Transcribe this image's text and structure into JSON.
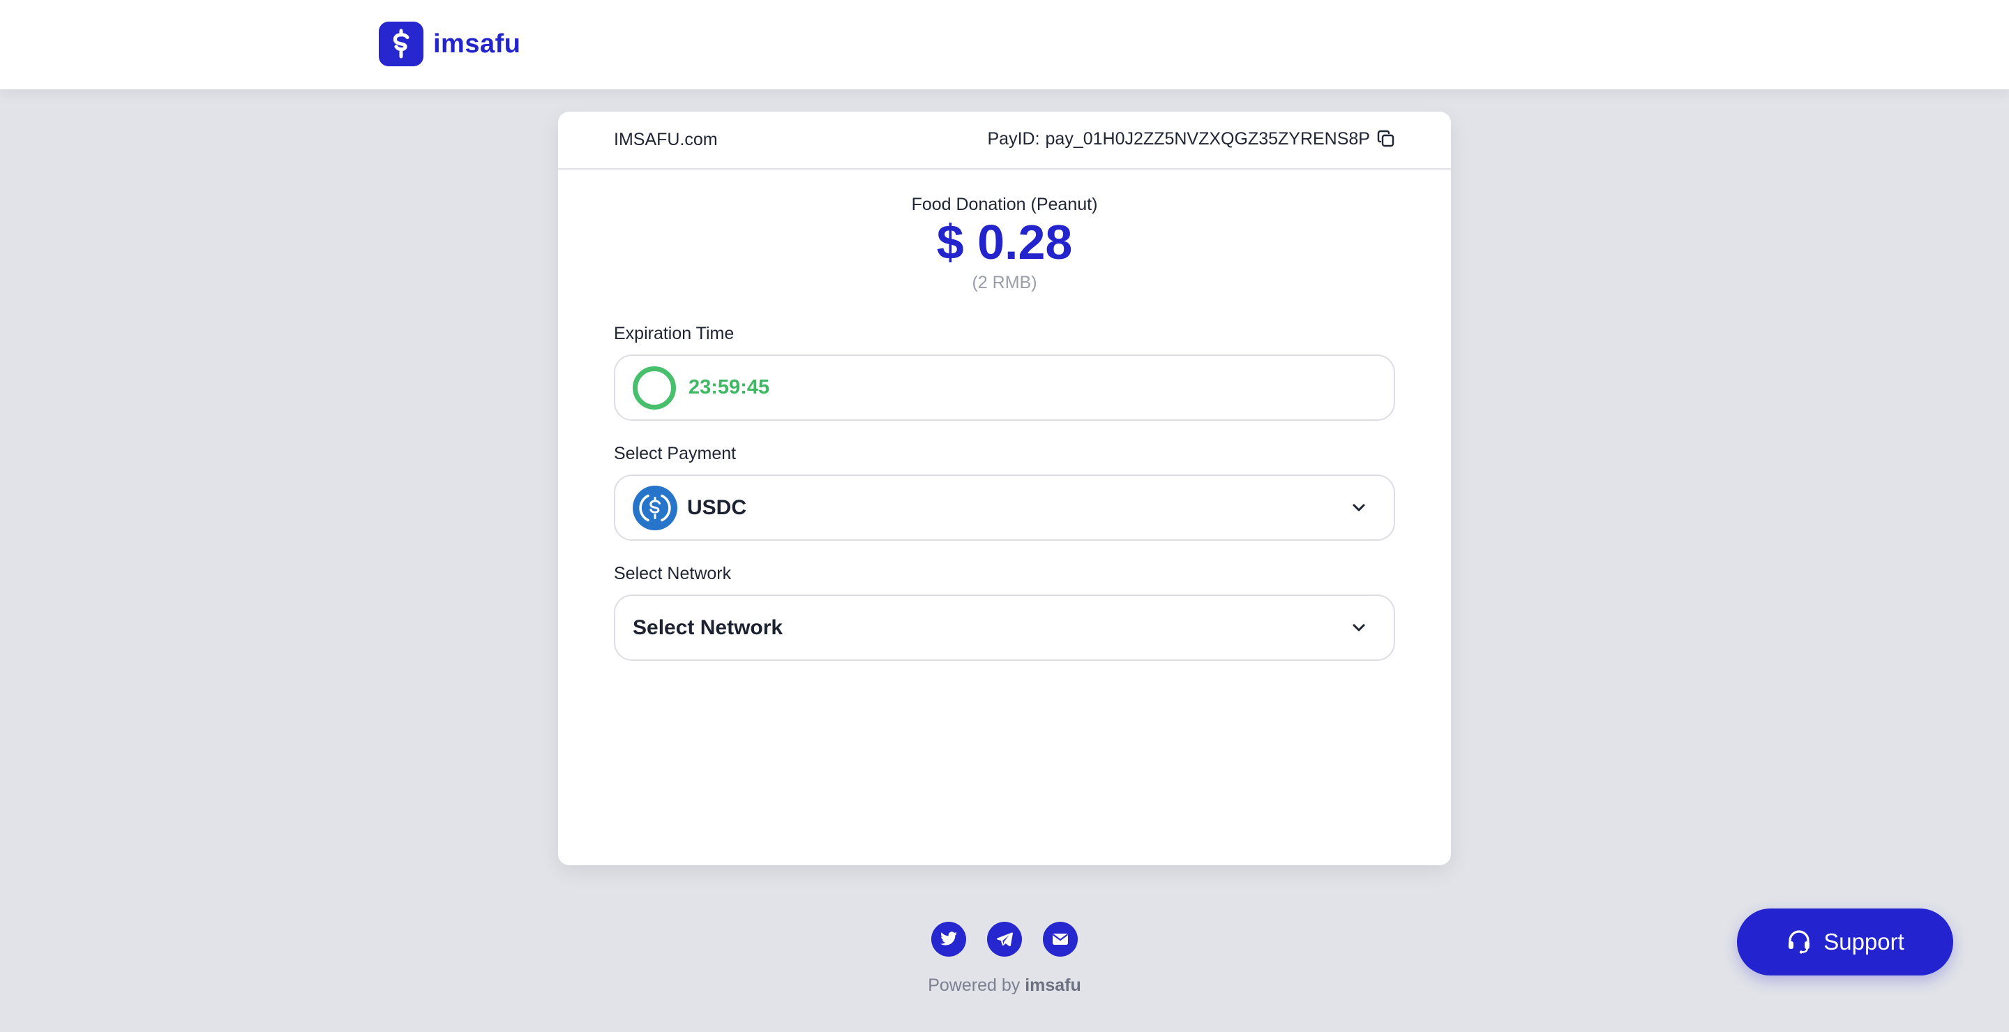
{
  "brand": {
    "name": "imsafu",
    "color": "#2424cc"
  },
  "card": {
    "merchant": "IMSAFU.com",
    "payid_label": "PayID:",
    "payid_value": "pay_01H0J2ZZ5NVZXQGZ35ZYRENS8P",
    "product_name": "Food Donation (Peanut)",
    "amount": "$ 0.28",
    "sub_amount": "(2 RMB)"
  },
  "expiration": {
    "label": "Expiration Time",
    "time": "23:59:45",
    "status_color": "#48bf6b"
  },
  "payment": {
    "label": "Select Payment",
    "selected": "USDC",
    "icon": "usdc-coin-icon"
  },
  "network": {
    "label": "Select Network",
    "selected": "Select Network"
  },
  "footer": {
    "social_icons": [
      "twitter-icon",
      "telegram-icon",
      "email-icon"
    ],
    "powered_prefix": "Powered by",
    "powered_brand": "imsafu"
  },
  "support": {
    "label": "Support",
    "icon": "headset-icon"
  },
  "colors": {
    "accent": "#2424cc",
    "background": "#e1e3e8",
    "success": "#48bf6b"
  }
}
